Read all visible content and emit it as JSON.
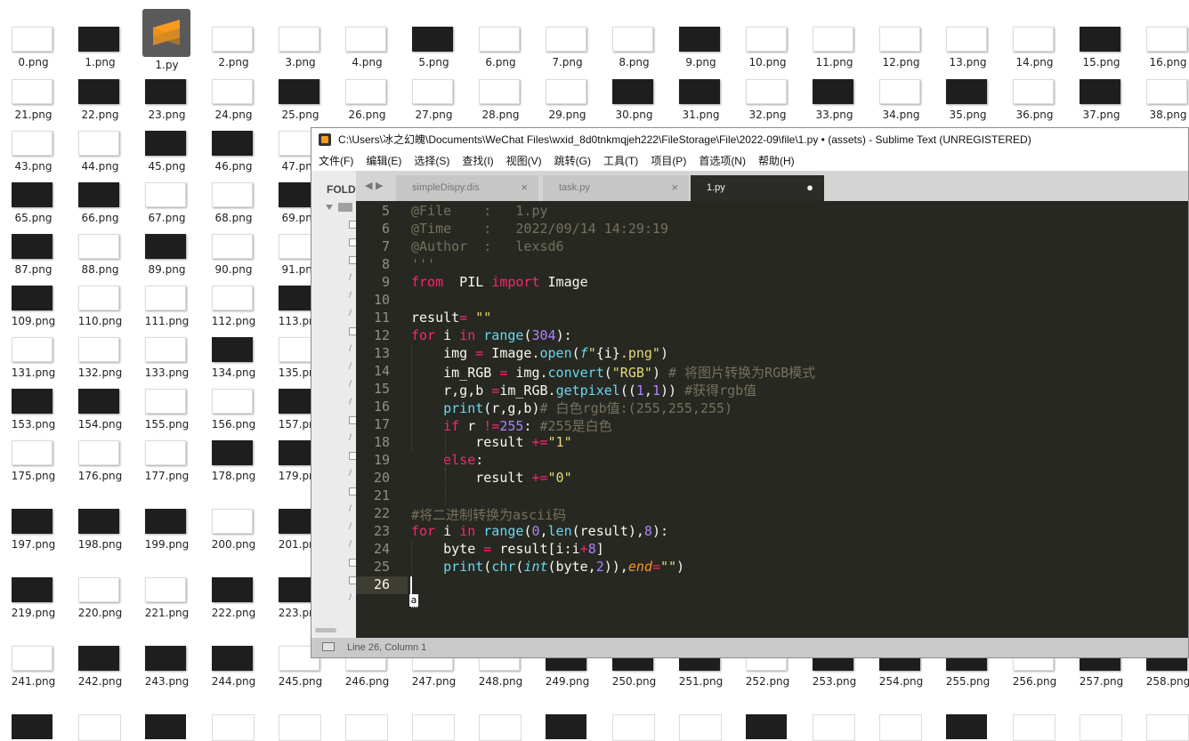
{
  "desktop": {
    "py_file": "1.py",
    "files": [
      {
        "name": "0.png",
        "c": "w"
      },
      {
        "name": "1.png",
        "c": "b"
      },
      {
        "name": "2.png",
        "c": "w"
      },
      {
        "name": "3.png",
        "c": "w"
      },
      {
        "name": "4.png",
        "c": "w"
      },
      {
        "name": "5.png",
        "c": "b"
      },
      {
        "name": "6.png",
        "c": "w"
      },
      {
        "name": "7.png",
        "c": "w"
      },
      {
        "name": "8.png",
        "c": "w"
      },
      {
        "name": "9.png",
        "c": "b"
      },
      {
        "name": "10.png",
        "c": "w"
      },
      {
        "name": "11.png",
        "c": "w"
      },
      {
        "name": "12.png",
        "c": "w"
      },
      {
        "name": "13.png",
        "c": "w"
      },
      {
        "name": "14.png",
        "c": "w"
      },
      {
        "name": "15.png",
        "c": "b"
      },
      {
        "name": "16.png",
        "c": "w"
      },
      {
        "name": "21.png",
        "c": "w"
      },
      {
        "name": "22.png",
        "c": "b"
      },
      {
        "name": "23.png",
        "c": "b"
      },
      {
        "name": "24.png",
        "c": "w"
      },
      {
        "name": "25.png",
        "c": "b"
      },
      {
        "name": "26.png",
        "c": "w"
      },
      {
        "name": "27.png",
        "c": "w"
      },
      {
        "name": "28.png",
        "c": "w"
      },
      {
        "name": "29.png",
        "c": "w"
      },
      {
        "name": "30.png",
        "c": "b"
      },
      {
        "name": "31.png",
        "c": "b"
      },
      {
        "name": "32.png",
        "c": "w"
      },
      {
        "name": "33.png",
        "c": "b"
      },
      {
        "name": "34.png",
        "c": "w"
      },
      {
        "name": "35.png",
        "c": "b"
      },
      {
        "name": "36.png",
        "c": "w"
      },
      {
        "name": "37.png",
        "c": "b"
      },
      {
        "name": "38.png",
        "c": "w"
      },
      {
        "name": "43.png",
        "c": "w"
      },
      {
        "name": "44.png",
        "c": "w"
      },
      {
        "name": "45.png",
        "c": "b"
      },
      {
        "name": "46.png",
        "c": "b"
      },
      {
        "name": "47.png",
        "c": "w"
      },
      {
        "name": "65.png",
        "c": "b"
      },
      {
        "name": "66.png",
        "c": "b"
      },
      {
        "name": "67.png",
        "c": "w"
      },
      {
        "name": "68.png",
        "c": "w"
      },
      {
        "name": "69.png",
        "c": "b"
      },
      {
        "name": "87.png",
        "c": "b"
      },
      {
        "name": "88.png",
        "c": "w"
      },
      {
        "name": "89.png",
        "c": "b"
      },
      {
        "name": "90.png",
        "c": "w"
      },
      {
        "name": "91.png",
        "c": "w"
      },
      {
        "name": "109.png",
        "c": "b"
      },
      {
        "name": "110.png",
        "c": "w"
      },
      {
        "name": "111.png",
        "c": "w"
      },
      {
        "name": "112.png",
        "c": "w"
      },
      {
        "name": "113.png",
        "c": "b"
      },
      {
        "name": "131.png",
        "c": "w"
      },
      {
        "name": "132.png",
        "c": "w"
      },
      {
        "name": "133.png",
        "c": "w"
      },
      {
        "name": "134.png",
        "c": "b"
      },
      {
        "name": "135.png",
        "c": "w"
      },
      {
        "name": "153.png",
        "c": "b"
      },
      {
        "name": "154.png",
        "c": "b"
      },
      {
        "name": "155.png",
        "c": "w"
      },
      {
        "name": "156.png",
        "c": "w"
      },
      {
        "name": "157.png",
        "c": "b"
      },
      {
        "name": "175.png",
        "c": "w"
      },
      {
        "name": "176.png",
        "c": "w"
      },
      {
        "name": "177.png",
        "c": "w"
      },
      {
        "name": "178.png",
        "c": "b"
      },
      {
        "name": "179.png",
        "c": "b"
      },
      {
        "name": "197.png",
        "c": "b"
      },
      {
        "name": "198.png",
        "c": "b"
      },
      {
        "name": "199.png",
        "c": "b"
      },
      {
        "name": "200.png",
        "c": "w"
      },
      {
        "name": "201.png",
        "c": "b"
      },
      {
        "name": "219.png",
        "c": "b"
      },
      {
        "name": "220.png",
        "c": "w"
      },
      {
        "name": "221.png",
        "c": "w"
      },
      {
        "name": "222.png",
        "c": "b"
      },
      {
        "name": "223.png",
        "c": "b"
      },
      {
        "name": "241.png",
        "c": "w"
      },
      {
        "name": "242.png",
        "c": "b"
      },
      {
        "name": "243.png",
        "c": "b"
      },
      {
        "name": "244.png",
        "c": "b"
      },
      {
        "name": "245.png",
        "c": "w"
      },
      {
        "name": "246.png",
        "c": "w"
      },
      {
        "name": "247.png",
        "c": "w"
      },
      {
        "name": "248.png",
        "c": "w"
      },
      {
        "name": "249.png",
        "c": "b"
      },
      {
        "name": "250.png",
        "c": "b"
      },
      {
        "name": "251.png",
        "c": "b"
      },
      {
        "name": "252.png",
        "c": "w"
      },
      {
        "name": "253.png",
        "c": "b"
      },
      {
        "name": "254.png",
        "c": "b"
      },
      {
        "name": "255.png",
        "c": "b"
      },
      {
        "name": "256.png",
        "c": "w"
      },
      {
        "name": "257.png",
        "c": "b"
      },
      {
        "name": "258.png",
        "c": "b"
      }
    ],
    "bottom_row": [
      "b",
      "w",
      "b",
      "w",
      "w",
      "w",
      "w",
      "w",
      "b",
      "w",
      "w",
      "b",
      "w",
      "w",
      "b",
      "w",
      "w",
      "w"
    ]
  },
  "window": {
    "title": "C:\\Users\\冰之幻魄\\Documents\\WeChat Files\\wxid_8d0tnkmqjeh222\\FileStorage\\File\\2022-09\\file\\1.py • (assets) - Sublime Text (UNREGISTERED)",
    "menu": [
      "文件(F)",
      "编辑(E)",
      "选择(S)",
      "查找(I)",
      "视图(V)",
      "跳转(G)",
      "工具(T)",
      "项目(P)",
      "首选项(N)",
      "帮助(H)"
    ],
    "sidebar_label": "FOLD",
    "tabs": [
      {
        "label": "simpleDispy.dis",
        "close": "×",
        "active": false
      },
      {
        "label": "task.py",
        "close": "×",
        "active": false
      },
      {
        "label": "1.py",
        "close": "●",
        "active": true
      }
    ],
    "status": "Line 26, Column 1",
    "ime_char": "a"
  },
  "editor": {
    "active_line": 26,
    "lines": [
      {
        "n": 5,
        "t": [
          [
            "c-com",
            "@File    :   1.py"
          ]
        ]
      },
      {
        "n": 6,
        "t": [
          [
            "c-com",
            "@Time    :   2022/09/14 14:29:19"
          ]
        ]
      },
      {
        "n": 7,
        "t": [
          [
            "c-com",
            "@Author  :   lexsd6"
          ]
        ]
      },
      {
        "n": 8,
        "t": [
          [
            "c-com",
            "'''"
          ]
        ]
      },
      {
        "n": 9,
        "t": [
          [
            "c-kw",
            "from"
          ],
          [
            "",
            "  PIL "
          ],
          [
            "c-kw",
            "import"
          ],
          [
            "",
            " Image"
          ]
        ]
      },
      {
        "n": 10,
        "t": []
      },
      {
        "n": 11,
        "t": [
          [
            "",
            "result"
          ],
          [
            "c-kw",
            "="
          ],
          [
            "",
            " "
          ],
          [
            "c-str",
            "\"\""
          ]
        ]
      },
      {
        "n": 12,
        "t": [
          [
            "c-kw",
            "for"
          ],
          [
            "",
            " i "
          ],
          [
            "c-kw",
            "in"
          ],
          [
            "",
            " "
          ],
          [
            "c-fn",
            "range"
          ],
          [
            "",
            "("
          ],
          [
            "c-num",
            "304"
          ],
          [
            "",
            "):"
          ]
        ]
      },
      {
        "n": 13,
        "t": [
          [
            "",
            "    img "
          ],
          [
            "c-kw",
            "="
          ],
          [
            "",
            " Image."
          ],
          [
            "c-fn",
            "open"
          ],
          [
            "",
            "("
          ],
          [
            "c-it",
            "f"
          ],
          [
            "c-str",
            "\""
          ],
          [
            "",
            "{i}"
          ],
          [
            "c-str",
            ".png\""
          ],
          [
            "",
            ")"
          ]
        ]
      },
      {
        "n": 14,
        "t": [
          [
            "",
            "    im_RGB "
          ],
          [
            "c-kw",
            "="
          ],
          [
            "",
            " img."
          ],
          [
            "c-fn",
            "convert"
          ],
          [
            "",
            "("
          ],
          [
            "c-str",
            "\"RGB\""
          ],
          [
            "",
            ") "
          ],
          [
            "c-com",
            "# 将图片转换为RGB模式"
          ]
        ]
      },
      {
        "n": 15,
        "t": [
          [
            "",
            "    r,g,b "
          ],
          [
            "c-kw",
            "="
          ],
          [
            "",
            "im_RGB."
          ],
          [
            "c-fn",
            "getpixel"
          ],
          [
            "",
            "(("
          ],
          [
            "c-num",
            "1"
          ],
          [
            "",
            ","
          ],
          [
            "c-num",
            "1"
          ],
          [
            "",
            "))"
          ],
          [
            "",
            " "
          ],
          [
            "c-com",
            "#获得rgb值"
          ]
        ]
      },
      {
        "n": 16,
        "t": [
          [
            "",
            "    "
          ],
          [
            "c-fn",
            "print"
          ],
          [
            "",
            "(r,g,b)"
          ],
          [
            "c-com",
            "# 白色rgb值:(255,255,255)"
          ]
        ]
      },
      {
        "n": 17,
        "t": [
          [
            "",
            "    "
          ],
          [
            "c-kw",
            "if"
          ],
          [
            "",
            " r "
          ],
          [
            "c-kw",
            "!="
          ],
          [
            "c-num",
            "255"
          ],
          [
            "",
            ": "
          ],
          [
            "c-com",
            "#255是白色"
          ]
        ]
      },
      {
        "n": 18,
        "t": [
          [
            "",
            "        result "
          ],
          [
            "c-kw",
            "+="
          ],
          [
            "c-str",
            "\"1\""
          ]
        ]
      },
      {
        "n": 19,
        "t": [
          [
            "",
            "    "
          ],
          [
            "c-kw",
            "else"
          ],
          [
            "",
            ":"
          ]
        ]
      },
      {
        "n": 20,
        "t": [
          [
            "",
            "        result "
          ],
          [
            "c-kw",
            "+="
          ],
          [
            "c-str",
            "\"0\""
          ]
        ]
      },
      {
        "n": 21,
        "t": []
      },
      {
        "n": 22,
        "t": [
          [
            "c-com",
            "#将二进制转换为ascii码"
          ]
        ]
      },
      {
        "n": 23,
        "t": [
          [
            "c-kw",
            "for"
          ],
          [
            "",
            " i "
          ],
          [
            "c-kw",
            "in"
          ],
          [
            "",
            " "
          ],
          [
            "c-fn",
            "range"
          ],
          [
            "",
            "("
          ],
          [
            "c-num",
            "0"
          ],
          [
            "",
            ","
          ],
          [
            "c-fn",
            "len"
          ],
          [
            "",
            "(result),"
          ],
          [
            "c-num",
            "8"
          ],
          [
            "",
            "):"
          ]
        ]
      },
      {
        "n": 24,
        "t": [
          [
            "",
            "    byte "
          ],
          [
            "c-kw",
            "="
          ],
          [
            "",
            " result[i:i"
          ],
          [
            "c-kw",
            "+"
          ],
          [
            "c-num",
            "8"
          ],
          [
            "",
            "]"
          ]
        ]
      },
      {
        "n": 25,
        "t": [
          [
            "",
            "    "
          ],
          [
            "c-fn",
            "print"
          ],
          [
            "",
            "("
          ],
          [
            "c-fn",
            "chr"
          ],
          [
            "",
            "("
          ],
          [
            "c-it",
            "int"
          ],
          [
            "",
            "(byte,"
          ],
          [
            "c-num",
            "2"
          ],
          [
            "",
            ")),"
          ],
          [
            "c-arg",
            "end"
          ],
          [
            "c-kw",
            "="
          ],
          [
            "c-str",
            "\"\""
          ],
          [
            "",
            ")"
          ]
        ]
      },
      {
        "n": 26,
        "t": []
      }
    ]
  }
}
